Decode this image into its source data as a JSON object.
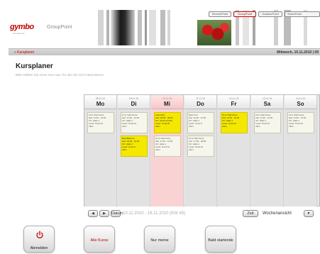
{
  "header": {
    "logo_text": "gymbo",
    "logo_subtext": "international",
    "product_name": "GroupPoint",
    "top_tabs": [
      {
        "label": "ServicePoint",
        "active": false
      },
      {
        "label": "GroupPoint",
        "active": true
      },
      {
        "label": "OutdoorPoint",
        "active": false
      },
      {
        "label": "SharePoint",
        "active": false
      }
    ]
  },
  "nav": {
    "breadcrumb": "» Kursplaner",
    "date": "Mittwoch, 10.11.2010 | 09"
  },
  "page": {
    "title": "Kursplaner",
    "hint": "Bitte wählen Sie einen Kurs aus, für den Sie sich interessieren."
  },
  "calendar": {
    "days": [
      {
        "date": "08.11.10",
        "name": "Mo",
        "today": false,
        "events": [
          {
            "title": "Fit & Vital Kurse",
            "time": "Zeit: 11:00 - 12:00",
            "place": "Ort: Halle 1",
            "trainer": "Leiter: Petra M.",
            "status": "offen",
            "yellow": false
          }
        ]
      },
      {
        "date": "09.11.10",
        "name": "Di",
        "today": false,
        "events": [
          {
            "title": "Fit & Vital Kurse",
            "time": "Zeit: 11:00 - 12:00",
            "place": "Ort: Halle 1",
            "trainer": "Leiter: Petra M.",
            "status": "offen",
            "yellow": false
          },
          {
            "title": "BodyBalance",
            "time": "Zeit: 18:00 - 19:00",
            "place": "Ort: Halle 2",
            "trainer": "Leiter: Anna K.",
            "status": "offen",
            "yellow": true
          }
        ]
      },
      {
        "date": "10.11.10",
        "name": "Mi",
        "today": true,
        "events": [
          {
            "title": "Aquarobic",
            "time": "Zeit: 08:00 - 09:00",
            "place": "Ort: Schwimmbad",
            "trainer": "Leiter: Sonja B.",
            "status": "offen",
            "yellow": true
          },
          {
            "title": "Fit & Vital Kurse",
            "time": "Zeit: 11:00 - 12:00",
            "place": "Ort: Halle 1",
            "trainer": "Leiter: Petra M.",
            "status": "offen",
            "yellow": false
          }
        ]
      },
      {
        "date": "11.11.10",
        "name": "Do",
        "today": false,
        "events": [
          {
            "title": "Bauch Fit",
            "time": "Zeit: 11:00 - 12:00",
            "place": "Ort: Halle 1",
            "trainer": "Leiter: Anna K.",
            "status": "offen",
            "yellow": false
          },
          {
            "title": "Fit & Vital Kurse",
            "time": "Zeit: 17:00 - 18:00",
            "place": "Ort: Halle 1",
            "trainer": "Leiter: Petra M.",
            "status": "offen",
            "yellow": false
          }
        ]
      },
      {
        "date": "12.11.10",
        "name": "Fr",
        "today": false,
        "events": [
          {
            "title": "Fit & Vital Kurse",
            "time": "Zeit: 11:00 - 12:00",
            "place": "Ort: Halle 1",
            "trainer": "Leiter: Petra M.",
            "status": "offen",
            "yellow": true
          }
        ]
      },
      {
        "date": "13.11.10",
        "name": "Sa",
        "today": false,
        "events": [
          {
            "title": "Fit & Vital Kurse",
            "time": "Zeit: 11:00 - 12:00",
            "place": "Ort: Halle 1",
            "trainer": "Leiter: Petra M.",
            "status": "offen",
            "yellow": false
          }
        ]
      },
      {
        "date": "14.11.10",
        "name": "So",
        "today": false,
        "events": [
          {
            "title": "Fit & Vital Kurse",
            "time": "Zeit: 11:00 - 12:00",
            "place": "Ort: Halle 1",
            "trainer": "Leiter: Petra M.",
            "status": "offen",
            "yellow": false
          }
        ]
      }
    ],
    "toolbar": {
      "prev_icon": "◀",
      "next_icon": "▶",
      "date_button": "Datum",
      "range": "10.11.2010 - 16.11.2010 (KW 45)",
      "time_button": "Zeit",
      "view_label": "Wochenansicht",
      "view_dropdown_icon": "▼"
    }
  },
  "buttons": {
    "logout": "Abmelden",
    "all_courses": "Alle Kurse",
    "only_mine": "Nur meine",
    "starting_soon": "Bald startende"
  },
  "colors": {
    "brand_red": "#c20000",
    "event_yellow": "#f5e800",
    "today_pink": "#f9d3d3"
  }
}
